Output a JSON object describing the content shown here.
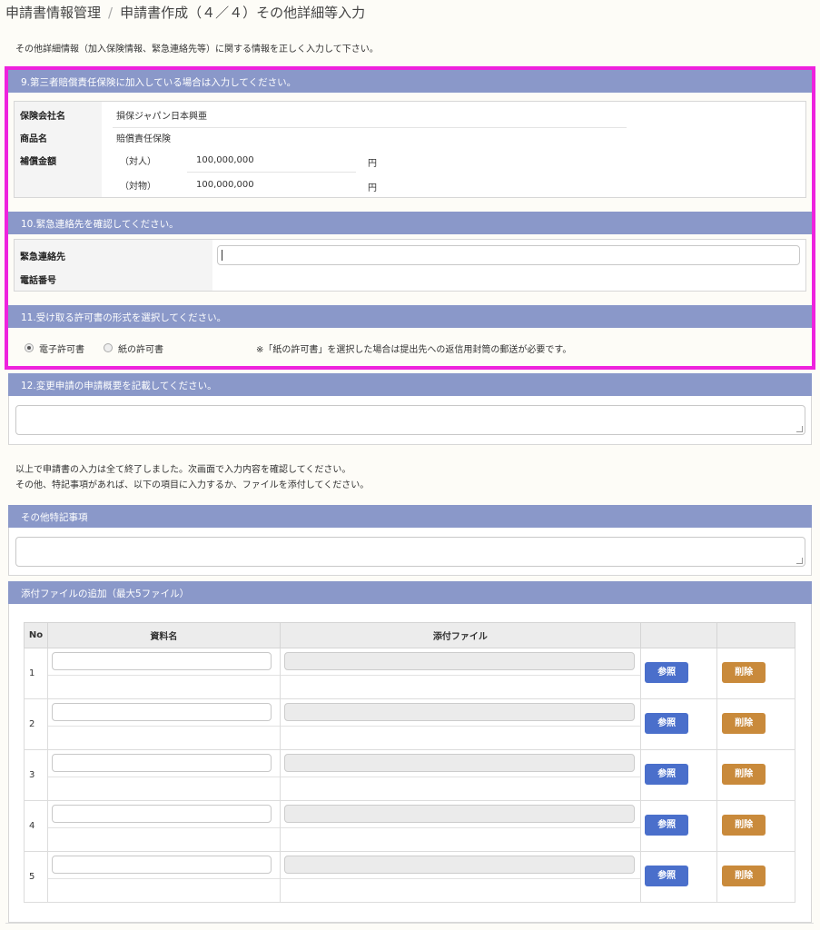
{
  "header": {
    "breadcrumb_root": "申請書情報管理",
    "breadcrumb_sep": "/",
    "page_title": "申請書作成（４／４）その他詳細等入力"
  },
  "intro": "その他詳細情報（加入保険情報、緊急連絡先等）に関する情報を正しく入力して下さい。",
  "section9": {
    "title": "9.第三者賠償責任保険に加入している場合は入力してください。",
    "company_label": "保険会社名",
    "company_value": "損保ジャパン日本興亜",
    "product_label": "商品名",
    "product_value": "賠償責任保険",
    "amount_label": "補償金額",
    "person_label": "（対人）",
    "person_value": "100,000,000",
    "property_label": "（対物）",
    "property_value": "100,000,000",
    "unit": "円"
  },
  "section10": {
    "title": "10.緊急連絡先を確認してください。",
    "contact_label": "緊急連絡先",
    "phone_label": "電話番号",
    "contact_value": ""
  },
  "section11": {
    "title": "11.受け取る許可書の形式を選択してください。",
    "option_electronic": "電子許可書",
    "option_paper": "紙の許可書",
    "selected": "電子許可書",
    "note": "※「紙の許可書」を選択した場合は提出先への返信用封筒の郵送が必要です。"
  },
  "section12": {
    "title": "12.変更申請の申請概要を記載してください。",
    "value": ""
  },
  "finish_note_1": "以上で申請書の入力は全て終了しました。次画面で入力内容を確認してください。",
  "finish_note_2": "その他、特記事項があれば、以下の項目に入力するか、ファイルを添付してください。",
  "special": {
    "title": "その他特記事項",
    "value": ""
  },
  "attachments": {
    "title": "添付ファイルの追加（最大5ファイル）",
    "col_no": "No",
    "col_name": "資料名",
    "col_file": "添付ファイル",
    "ref_label": "参照",
    "del_label": "削除",
    "rows": [
      {
        "no": "1"
      },
      {
        "no": "2"
      },
      {
        "no": "3"
      },
      {
        "no": "4"
      },
      {
        "no": "5"
      }
    ]
  },
  "colors": {
    "section_header": "#8a98c9",
    "highlight": "#ee22dd",
    "ref_button": "#4a6fcb",
    "del_button": "#c98a3b"
  }
}
